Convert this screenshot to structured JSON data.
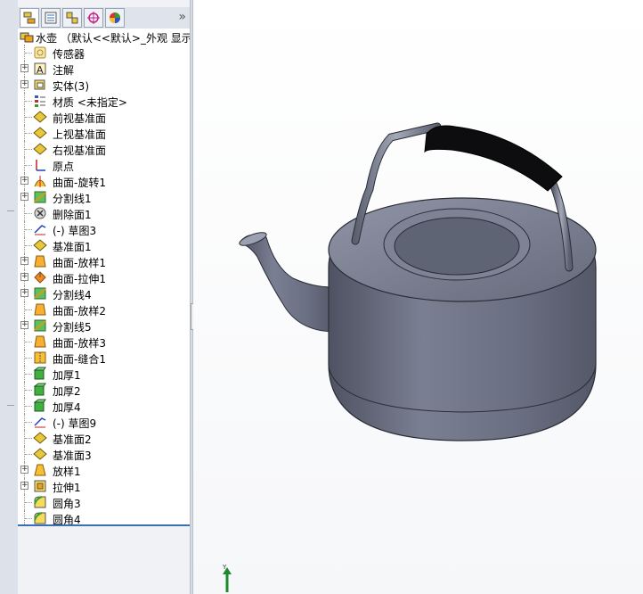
{
  "tree": {
    "root": {
      "label": "水壶 （默认<<默认>_外观 显示状",
      "icon": "part-icon"
    },
    "items": [
      {
        "label": "传感器",
        "icon": "sensor-icon",
        "expandable": false
      },
      {
        "label": "注解",
        "icon": "annotation-icon",
        "expandable": true
      },
      {
        "label": "实体(3)",
        "icon": "solid-bodies-icon",
        "expandable": true
      },
      {
        "label": "材质 <未指定>",
        "icon": "material-icon",
        "expandable": false
      },
      {
        "label": "前视基准面",
        "icon": "plane-icon",
        "expandable": false
      },
      {
        "label": "上视基准面",
        "icon": "plane-icon",
        "expandable": false
      },
      {
        "label": "右视基准面",
        "icon": "plane-icon",
        "expandable": false
      },
      {
        "label": "原点",
        "icon": "origin-icon",
        "expandable": false
      },
      {
        "label": "曲面-旋转1",
        "icon": "surface-revolve-icon",
        "expandable": true
      },
      {
        "label": "分割线1",
        "icon": "split-line-icon",
        "expandable": true
      },
      {
        "label": "删除面1",
        "icon": "delete-face-icon",
        "expandable": false
      },
      {
        "label": "(-) 草图3",
        "icon": "sketch-icon",
        "expandable": false
      },
      {
        "label": "基准面1",
        "icon": "plane-icon",
        "expandable": false
      },
      {
        "label": "曲面-放样1",
        "icon": "surface-loft-icon",
        "expandable": true
      },
      {
        "label": "曲面-拉伸1",
        "icon": "surface-extrude-icon",
        "expandable": true
      },
      {
        "label": "分割线4",
        "icon": "split-line-icon",
        "expandable": true
      },
      {
        "label": "曲面-放样2",
        "icon": "surface-loft-icon",
        "expandable": false
      },
      {
        "label": "分割线5",
        "icon": "split-line-icon",
        "expandable": true
      },
      {
        "label": "曲面-放样3",
        "icon": "surface-loft-icon",
        "expandable": false
      },
      {
        "label": "曲面-缝合1",
        "icon": "surface-knit-icon",
        "expandable": false
      },
      {
        "label": "加厚1",
        "icon": "thicken-icon",
        "expandable": false
      },
      {
        "label": "加厚2",
        "icon": "thicken-icon",
        "expandable": false
      },
      {
        "label": "加厚4",
        "icon": "thicken-icon",
        "expandable": false
      },
      {
        "label": "(-) 草图9",
        "icon": "sketch-icon",
        "expandable": false
      },
      {
        "label": "基准面2",
        "icon": "plane-icon",
        "expandable": false
      },
      {
        "label": "基准面3",
        "icon": "plane-icon",
        "expandable": false
      },
      {
        "label": "放样1",
        "icon": "loft-icon",
        "expandable": true
      },
      {
        "label": "拉伸1",
        "icon": "extrude-icon",
        "expandable": true
      },
      {
        "label": "圆角3",
        "icon": "fillet-icon",
        "expandable": false
      },
      {
        "label": "圆角4",
        "icon": "fillet-icon",
        "expandable": false
      }
    ]
  },
  "tabs": [
    "feature-manager-tab",
    "property-manager-tab",
    "configuration-manager-tab",
    "dimxpert-tab",
    "display-manager-tab"
  ],
  "tabs_more": "»",
  "triad": {
    "y_label": "Y"
  },
  "colors": {
    "plane": "#e8c83a",
    "feature": "#f0a010",
    "body": "#6a6f80",
    "accent": "#3a6fb7"
  }
}
